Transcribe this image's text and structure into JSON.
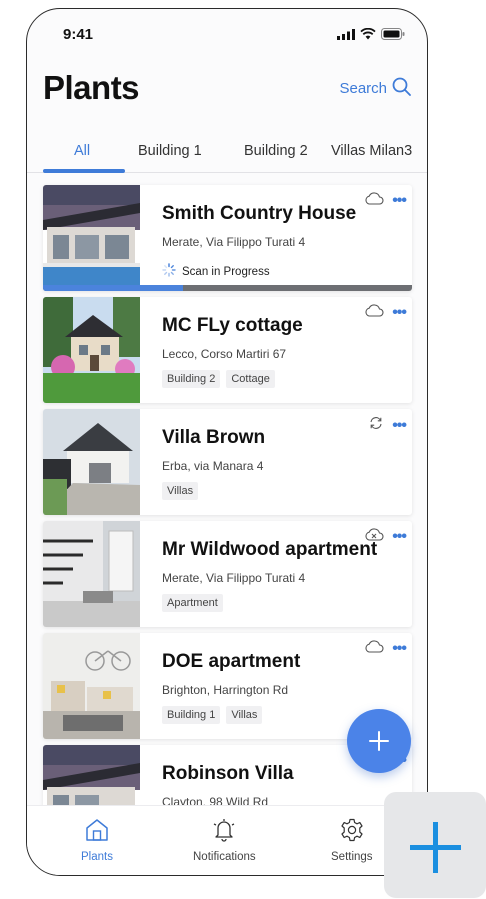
{
  "status_bar": {
    "time": "9:41"
  },
  "header": {
    "title": "Plants",
    "search_label": "Search"
  },
  "tabs": [
    {
      "label": "All"
    },
    {
      "label": "Building 1"
    },
    {
      "label": "Building 2"
    },
    {
      "label": "Villas Milan3"
    }
  ],
  "plants": [
    {
      "name": "Smith Country House",
      "address": "Merate, Via Filippo Turati 4",
      "status": "Scan in Progress",
      "progress": 0.38,
      "icon": "cloud-icon",
      "tags": []
    },
    {
      "name": "MC FLy cottage",
      "address": "Lecco, Corso Martiri 67",
      "icon": "cloud-icon",
      "tags": [
        "Building 2",
        "Cottage"
      ]
    },
    {
      "name": "Villa Brown",
      "address": "Erba, via Manara 4",
      "icon": "sync-icon",
      "tags": [
        "Villas"
      ]
    },
    {
      "name": "Mr Wildwood apartment",
      "address": "Merate, Via Filippo Turati 4",
      "icon": "cloud-off-icon",
      "tags": [
        "Apartment"
      ]
    },
    {
      "name": "DOE apartment",
      "address": "Brighton,  Harrington Rd",
      "icon": "cloud-icon",
      "tags": [
        "Building 1",
        "Villas"
      ]
    },
    {
      "name": "Robinson Villa",
      "address": "Clayton, 98 Wild Rd",
      "icon": "cloud-icon",
      "tags": []
    }
  ],
  "bottom_nav": [
    {
      "label": "Plants",
      "icon": "home-icon"
    },
    {
      "label": "Notifications",
      "icon": "bell-icon"
    },
    {
      "label": "Settings",
      "icon": "gear-icon"
    }
  ],
  "colors": {
    "accent": "#3e7bd8",
    "fab": "#4b83e8",
    "progress_track": "#6d6f73",
    "corner_plus": "#1b8fe0"
  }
}
